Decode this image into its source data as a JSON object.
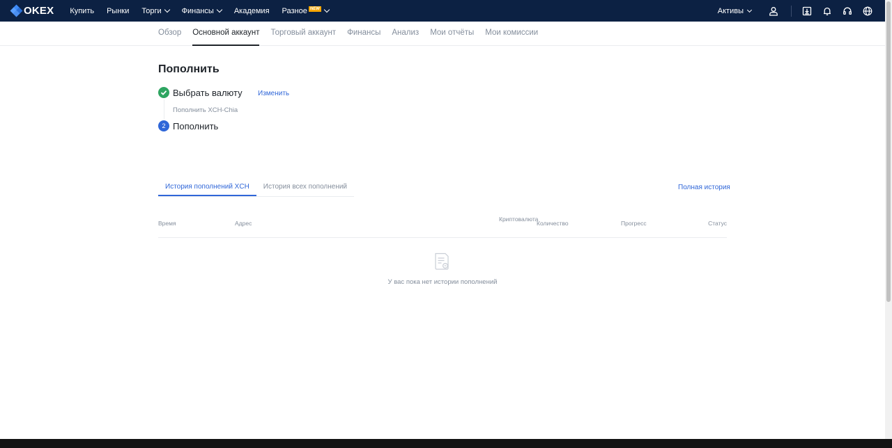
{
  "header": {
    "logo_text": "OKEX",
    "nav": [
      {
        "label": "Купить",
        "chevron": false
      },
      {
        "label": "Рынки",
        "chevron": false
      },
      {
        "label": "Торги",
        "chevron": true
      },
      {
        "label": "Финансы",
        "chevron": true
      },
      {
        "label": "Академия",
        "chevron": false
      },
      {
        "label": "Разное",
        "chevron": true,
        "badge": "NEW"
      }
    ],
    "assets_label": "Активы",
    "icons": [
      "user-icon",
      "download-icon",
      "bell-icon",
      "headset-icon",
      "globe-icon"
    ]
  },
  "subnav": {
    "tabs": [
      "Обзор",
      "Основной аккаунт",
      "Торговый аккаунт",
      "Финансы",
      "Анализ",
      "Мои отчёты",
      "Мои комиссии"
    ],
    "active": "Основной аккаунт"
  },
  "deposit": {
    "title": "Пополнить",
    "step1_label": "Выбрать валюту",
    "step1_change": "Изменить",
    "step1_selected": "Пополнить XCH-Chia",
    "step2_number": "2",
    "step2_label": "Пополнить"
  },
  "history": {
    "tabs": [
      "История пополнений XCH",
      "История всех пополнений"
    ],
    "active_tab": "История пополнений XCH",
    "full_history_link": "Полная история",
    "columns": {
      "time": "Время",
      "address": "Адрес",
      "crypto": "Криптовалюта",
      "quantity": "Количество",
      "progress": "Прогресс",
      "status": "Статус"
    },
    "empty_text": "У вас пока нет истории пополнений"
  },
  "colors": {
    "header_bg": "#0c2143",
    "accent": "#2f66d8",
    "success": "#2ea561",
    "badge": "#f7a600"
  }
}
